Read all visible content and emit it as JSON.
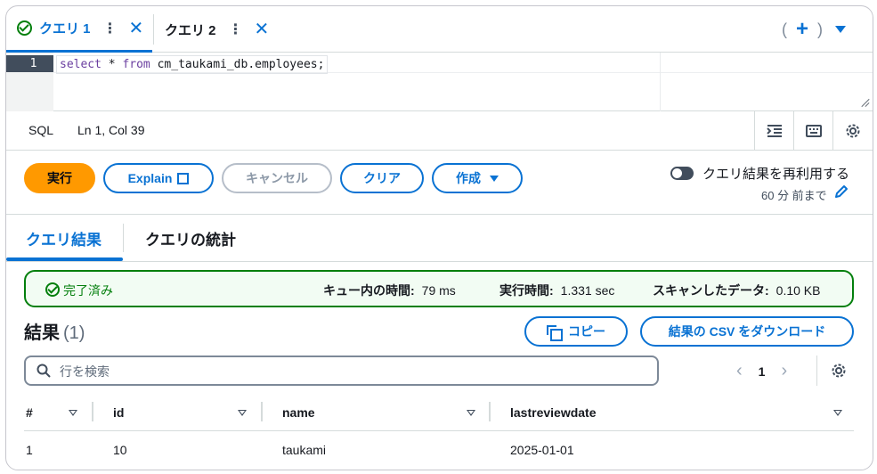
{
  "tabs": [
    {
      "label": "クエリ 1",
      "active": true,
      "status": "success"
    },
    {
      "label": "クエリ 2",
      "active": false
    }
  ],
  "tab_controls": {
    "open_paren": "(",
    "close_paren": ")"
  },
  "editor": {
    "line_number": "1",
    "code_keyword_1": "select",
    "code_mid_1": " * ",
    "code_keyword_2": "from",
    "code_mid_2": " cm_taukami_db.employees;"
  },
  "status_bar": {
    "language": "SQL",
    "cursor": "Ln 1, Col 39"
  },
  "actions": {
    "run": "実行",
    "explain": "Explain",
    "cancel": "キャンセル",
    "clear": "クリア",
    "create": "作成",
    "reuse_label": "クエリ結果を再利用する",
    "reuse_age": "60 分 前まで",
    "reuse_enabled": false
  },
  "result_tabs": {
    "results": "クエリ結果",
    "stats": "クエリの統計"
  },
  "alert": {
    "status": "完了済み",
    "queue_label": "キュー内の時間:",
    "queue_value": "79 ms",
    "exec_label": "実行時間:",
    "exec_value": "1.331 sec",
    "scan_label": "スキャンしたデータ:",
    "scan_value": "0.10 KB"
  },
  "results": {
    "title": "結果",
    "count": "(1)",
    "copy": "コピー",
    "download": "結果の CSV をダウンロード",
    "search_placeholder": "行を検索",
    "page": "1",
    "columns": [
      "#",
      "id",
      "name",
      "lastreviewdate"
    ],
    "rows": [
      [
        "1",
        "10",
        "taukami",
        "2025-01-01"
      ]
    ]
  },
  "colors": {
    "accent": "#0972d3",
    "run": "#ff9900",
    "success": "#037f0c"
  }
}
